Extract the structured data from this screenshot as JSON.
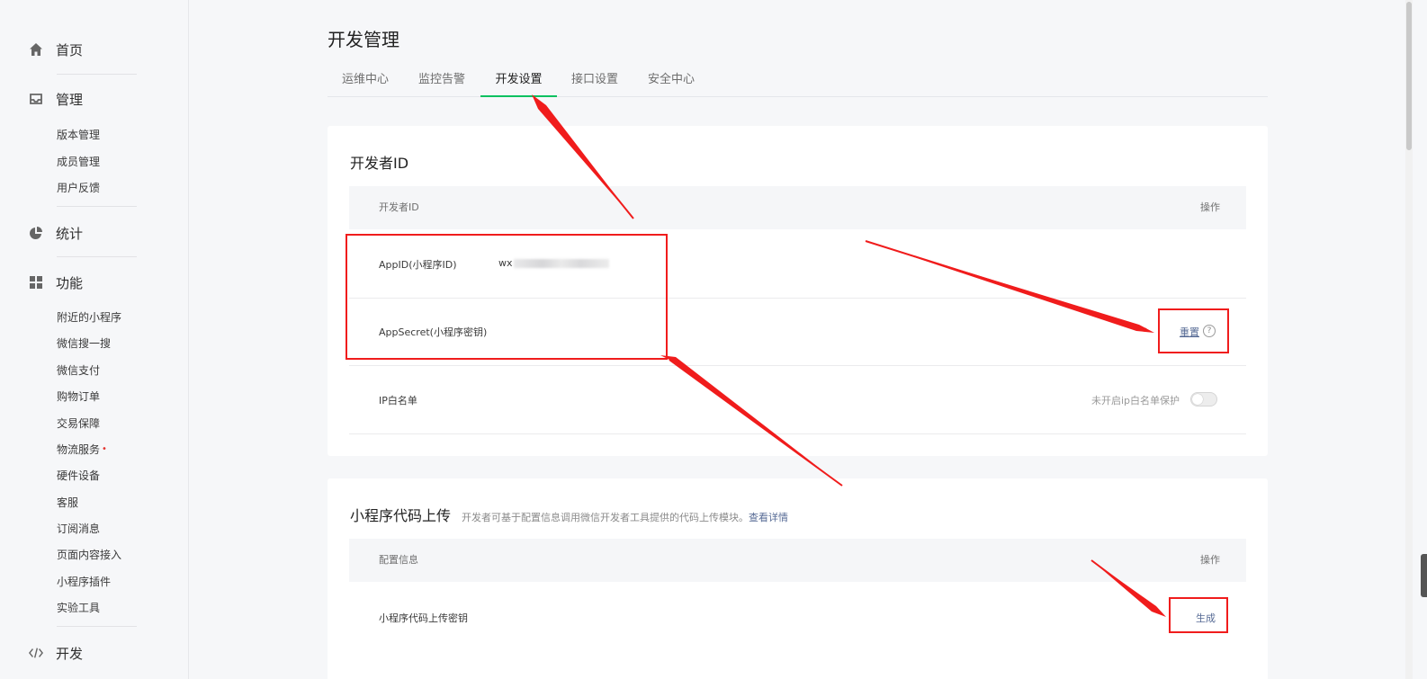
{
  "sidebar": {
    "groups": [
      {
        "icon": "home-icon",
        "label": "首页"
      },
      {
        "icon": "inbox-icon",
        "label": "管理"
      },
      {
        "icon": "pie-chart-icon",
        "label": "统计"
      },
      {
        "icon": "grid-icon",
        "label": "功能"
      },
      {
        "icon": "code-icon",
        "label": "开发"
      }
    ],
    "manage_items": [
      "版本管理",
      "成员管理",
      "用户反馈"
    ],
    "feature_items": [
      "附近的小程序",
      "微信搜一搜",
      "微信支付",
      "购物订单",
      "交易保障",
      "物流服务",
      "硬件设备",
      "客服",
      "订阅消息",
      "页面内容接入",
      "小程序插件",
      "实验工具"
    ],
    "new_badge": "•"
  },
  "page": {
    "title": "开发管理",
    "tabs": [
      "运维中心",
      "监控告警",
      "开发设置",
      "接口设置",
      "安全中心"
    ],
    "active_tab": "开发设置"
  },
  "developer_card": {
    "title": "开发者ID",
    "header_left": "开发者ID",
    "header_right": "操作",
    "appid_label": "AppID(小程序ID)",
    "appid_value": "wx",
    "secret_label": "AppSecret(小程序密钥)",
    "secret_action": "重置",
    "help_icon": "?",
    "ip_label": "IP白名单",
    "ip_toggle_label": "未开启ip白名单保护"
  },
  "upload_card": {
    "title": "小程序代码上传",
    "desc": "开发者可基于配置信息调用微信开发者工具提供的代码上传模块。",
    "desc_link": "查看详情",
    "header_left": "配置信息",
    "header_right": "操作",
    "key_label": "小程序代码上传密钥",
    "key_action": "生成"
  },
  "colors": {
    "accent_green": "#07c160",
    "link_blue": "#576b95",
    "annotation_red": "#f01c1c"
  }
}
